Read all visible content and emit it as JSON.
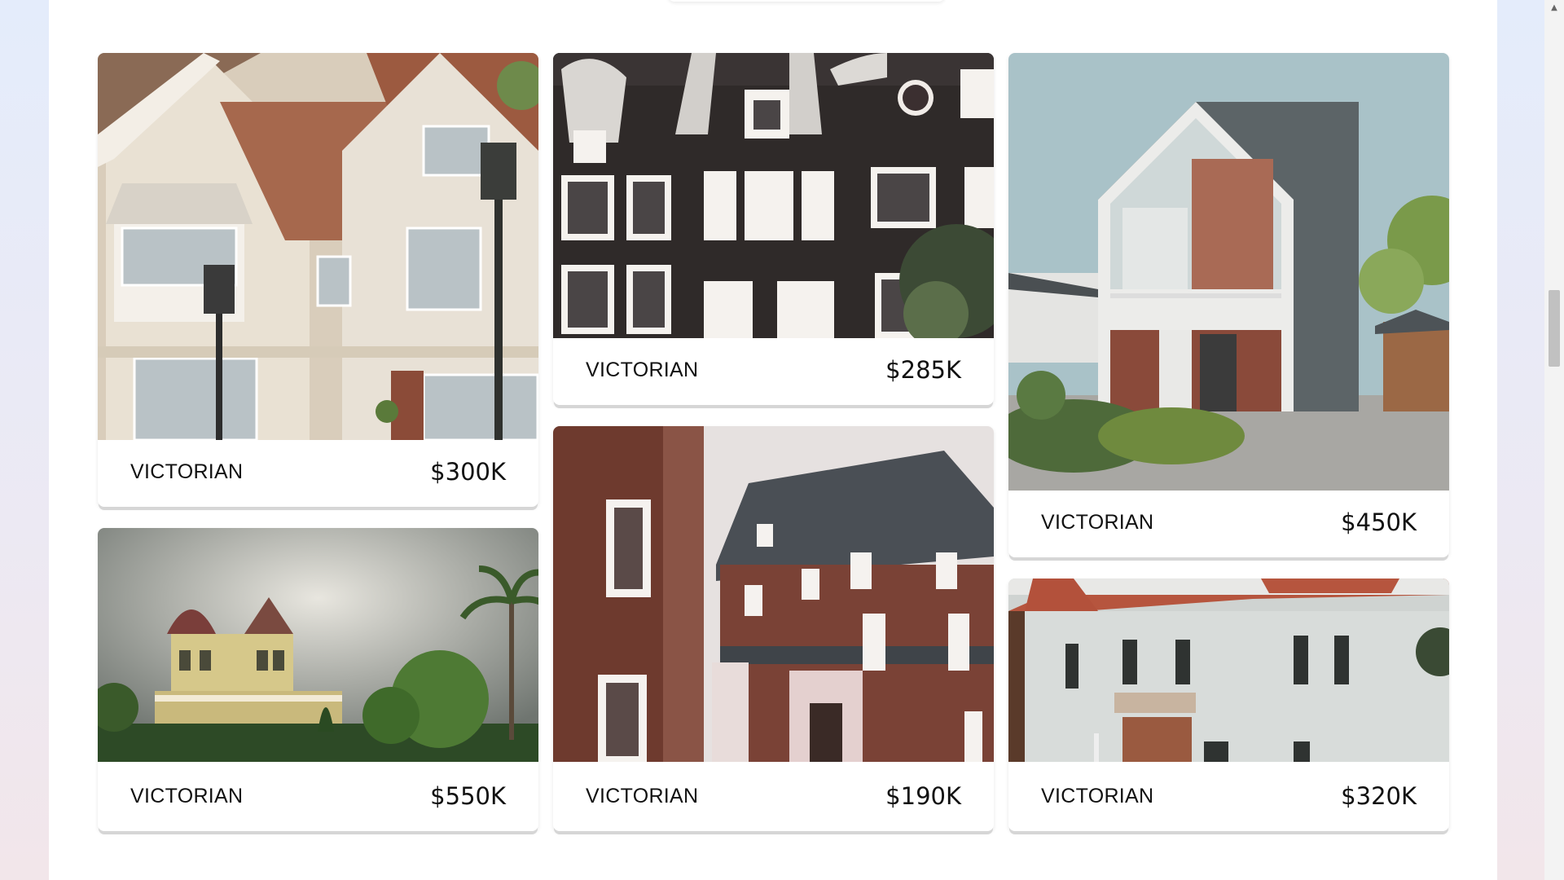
{
  "listings": [
    {
      "style": "VICTORIAN",
      "price": "$300K"
    },
    {
      "style": "VICTORIAN",
      "price": "$285K"
    },
    {
      "style": "VICTORIAN",
      "price": "$450K"
    },
    {
      "style": "VICTORIAN",
      "price": "$550K"
    },
    {
      "style": "VICTORIAN",
      "price": "$190K"
    },
    {
      "style": "VICTORIAN",
      "price": "$320K"
    }
  ],
  "scrollbar": {
    "up_arrow_icon": "▲"
  }
}
